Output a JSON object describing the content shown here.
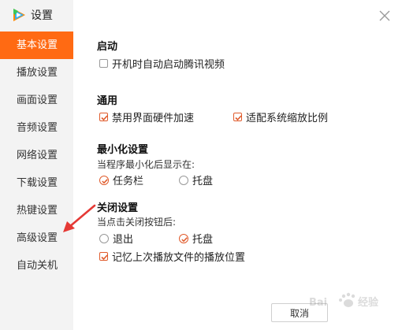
{
  "app": {
    "title": "设置",
    "logo_icon": "tencent-video-logo-icon"
  },
  "sidebar": {
    "items": [
      {
        "label": "基本设置",
        "active": true
      },
      {
        "label": "播放设置"
      },
      {
        "label": "画面设置"
      },
      {
        "label": "音频设置"
      },
      {
        "label": "网络设置"
      },
      {
        "label": "下载设置"
      },
      {
        "label": "热键设置"
      },
      {
        "label": "高级设置"
      },
      {
        "label": "自动关机"
      }
    ]
  },
  "sections": {
    "startup": {
      "title": "启动",
      "autostart_label": "开机时自动启动腾讯视频",
      "autostart_checked": false
    },
    "general": {
      "title": "通用",
      "hw_accel_label": "禁用界面硬件加速",
      "hw_accel_checked": true,
      "dpi_scale_label": "适配系统缩放比例",
      "dpi_scale_checked": true
    },
    "minimize": {
      "title": "最小化设置",
      "desc": "当程序最小化后显示在:",
      "taskbar_label": "任务栏",
      "tray_label": "托盘",
      "selected": "任务栏"
    },
    "close": {
      "title": "关闭设置",
      "desc": "当点击关闭按钮后:",
      "exit_label": "退出",
      "tray_label": "托盘",
      "selected": "托盘",
      "remember_label": "记忆上次播放文件的播放位置",
      "remember_checked": true
    }
  },
  "footer": {
    "cancel_label": "取消"
  },
  "colors": {
    "accent": "#ff6a13",
    "check": "#e05a2b",
    "sidebar_bg": "#f3f3f3",
    "annotation_arrow": "#e53935"
  },
  "watermark": {
    "text": "Bai",
    "icon": "baidu-paw-icon",
    "suffix": "经验"
  }
}
